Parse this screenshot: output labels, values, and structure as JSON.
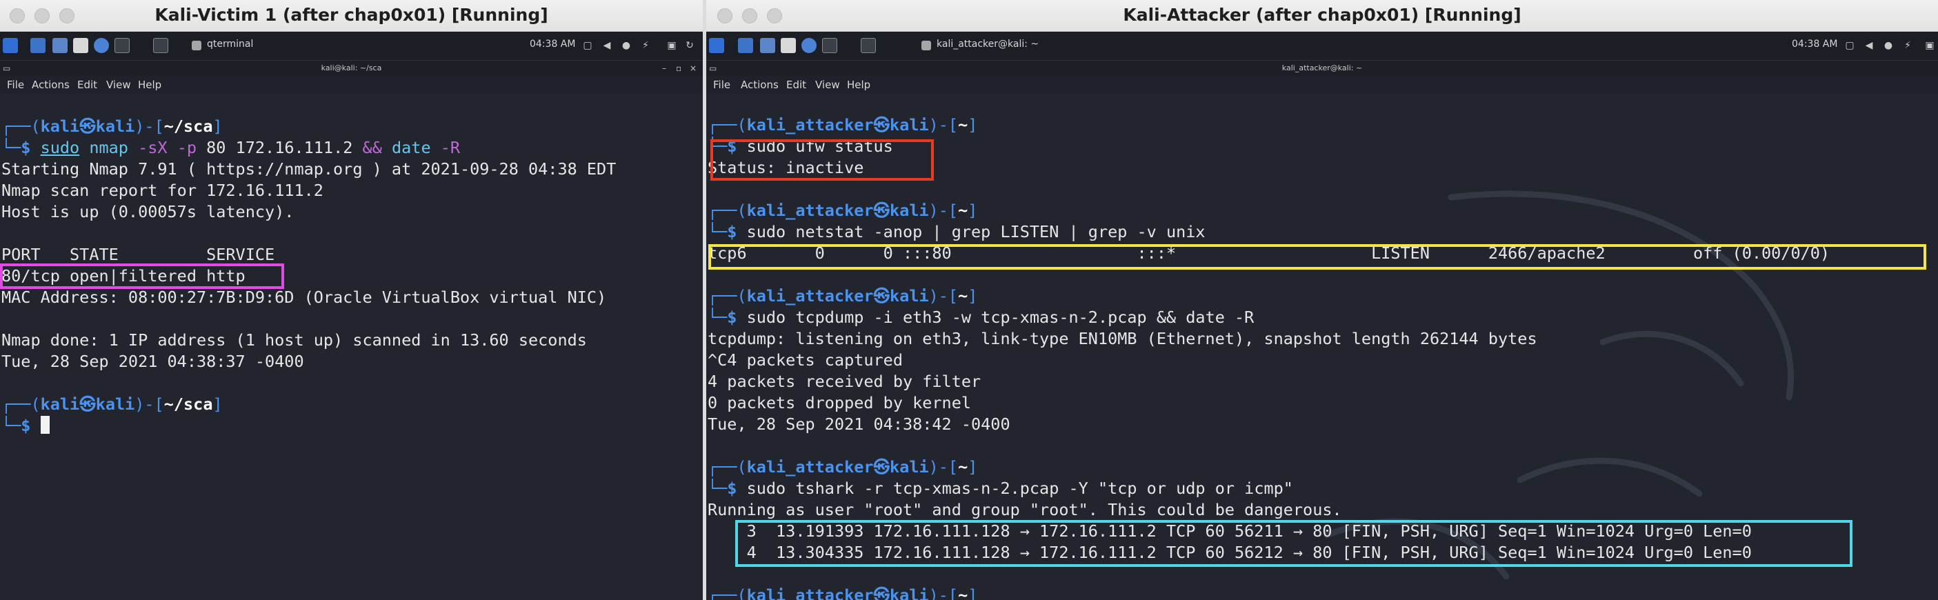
{
  "left": {
    "window_title": "Kali-Victim 1 (after chap0x01) [Running]",
    "panel": {
      "task_label": "qterminal",
      "clock": "04:38 AM"
    },
    "terminal_title": "kali@kali: ~/sca",
    "menu": [
      "File",
      "Actions",
      "Edit",
      "View",
      "Help"
    ],
    "prompt1": {
      "user": "kali",
      "host": "kali",
      "path": "~/sca",
      "sudo": "sudo",
      "cmd1": "nmap",
      "flags": "-sX -p",
      "args": "80 172.16.111.2",
      "amp": "&&",
      "cmd2": "date",
      "cmd2_flag": "-R"
    },
    "output": [
      "Starting Nmap 7.91 ( https://nmap.org ) at 2021-09-28 04:38 EDT",
      "Nmap scan report for 172.16.111.2",
      "Host is up (0.00057s latency).",
      "",
      "PORT   STATE         SERVICE",
      "80/tcp open|filtered http",
      "MAC Address: 08:00:27:7B:D9:6D (Oracle VirtualBox virtual NIC)",
      "",
      "Nmap done: 1 IP address (1 host up) scanned in 13.60 seconds",
      "Tue, 28 Sep 2021 04:38:37 -0400"
    ],
    "prompt2": {
      "user": "kali",
      "host": "kali",
      "path": "~/sca"
    }
  },
  "right": {
    "window_title": "Kali-Attacker (after chap0x01) [Running]",
    "panel": {
      "task_label": "kali_attacker@kali: ~",
      "clock": "04:38 AM"
    },
    "terminal_title": "kali_attacker@kali: ~",
    "menu": [
      "File",
      "Actions",
      "Edit",
      "View",
      "Help"
    ],
    "blocks": [
      {
        "user": "kali_attacker",
        "host": "kali",
        "path": "~",
        "command": "sudo ufw status",
        "output": [
          "Status: inactive"
        ]
      },
      {
        "user": "kali_attacker",
        "host": "kali",
        "path": "~",
        "command": "sudo netstat -anop | grep LISTEN | grep -v unix",
        "output": [
          "tcp6       0      0 :::80                   :::*                    LISTEN      2466/apache2         off (0.00/0/0)"
        ]
      },
      {
        "user": "kali_attacker",
        "host": "kali",
        "path": "~",
        "command": "sudo tcpdump -i eth3 -w tcp-xmas-n-2.pcap && date -R",
        "output": [
          "tcpdump: listening on eth3, link-type EN10MB (Ethernet), snapshot length 262144 bytes",
          "^C4 packets captured",
          "4 packets received by filter",
          "0 packets dropped by kernel",
          "Tue, 28 Sep 2021 04:38:42 -0400"
        ]
      },
      {
        "user": "kali_attacker",
        "host": "kali",
        "path": "~",
        "command": "sudo tshark -r tcp-xmas-n-2.pcap -Y \"tcp or udp or icmp\"",
        "output": [
          "Running as user \"root\" and group \"root\". This could be dangerous.",
          "    3  13.191393 172.16.111.128 → 172.16.111.2 TCP 60 56211 → 80 [FIN, PSH, URG] Seq=1 Win=1024 Urg=0 Len=0",
          "    4  13.304335 172.16.111.128 → 172.16.111.2 TCP 60 56212 → 80 [FIN, PSH, URG] Seq=1 Win=1024 Urg=0 Len=0"
        ]
      },
      {
        "user": "kali_attacker",
        "host": "kali",
        "path": "~",
        "command": "",
        "output": []
      }
    ]
  },
  "glyphs": {
    "prompt_top": "┌──(",
    "prompt_sep": "㉿",
    "prompt_mid": ")-[",
    "prompt_end": "]",
    "prompt_bottom": "└─",
    "dollar": "$"
  },
  "highlight_colors": {
    "magenta": "#e04be6",
    "red": "#e53b25",
    "yellow": "#f2e644",
    "cyan": "#4fd8e8"
  }
}
